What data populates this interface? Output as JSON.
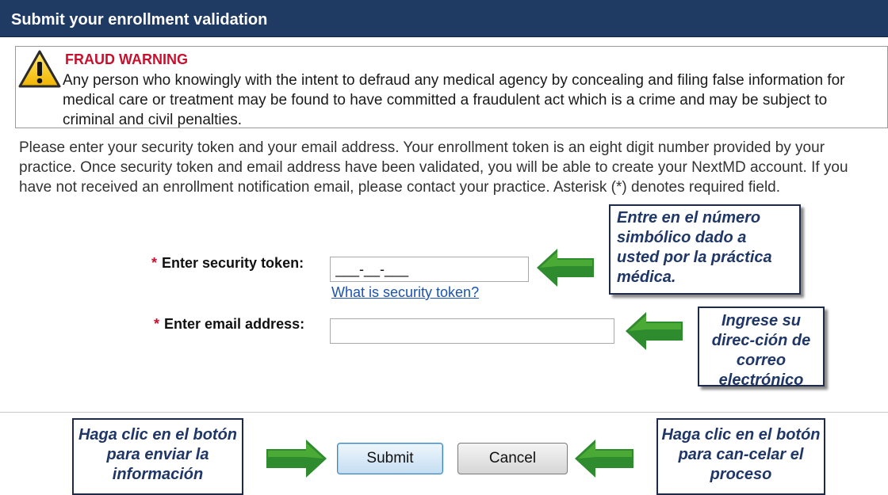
{
  "header": {
    "title": "Submit your enrollment validation"
  },
  "warning": {
    "icon": "warning-triangle-icon",
    "title": "FRAUD WARNING",
    "text": "Any person who knowingly with the intent to defraud any medical agency by concealing and filing false information for medical care or treatment may be found to have committed a fraudulent act which is a crime and may be subject to criminal and civil penalties."
  },
  "intro": {
    "text": "Please enter your security token and your email address. Your enrollment token is an eight digit number provided by your practice. Once security token and email address have been validated, you will be able to create your NextMD account. If you have not received an enrollment notification email, please contact your practice. Asterisk (*) denotes required field."
  },
  "form": {
    "required_marker": "*",
    "token_label": "Enter security token:",
    "token_value": "___-__-___",
    "token_help_link": "What is security token?",
    "email_label": "Enter email address:",
    "email_value": ""
  },
  "buttons": {
    "submit": "Submit",
    "cancel": "Cancel"
  },
  "callouts": {
    "token": "Entre en el número simbólico dado a usted por la práctica médica.",
    "email": "Ingrese su direc-ción de correo electrónico",
    "submit": "Haga clic en el botón para enviar la información",
    "cancel": "Haga clic en el botón para can-celar el proceso"
  },
  "colors": {
    "header_bg": "#1f3a63",
    "warning_title": "#c8102e",
    "callout_text": "#1f3668",
    "arrow": "#2e8b2e",
    "link": "#1a53b0"
  }
}
